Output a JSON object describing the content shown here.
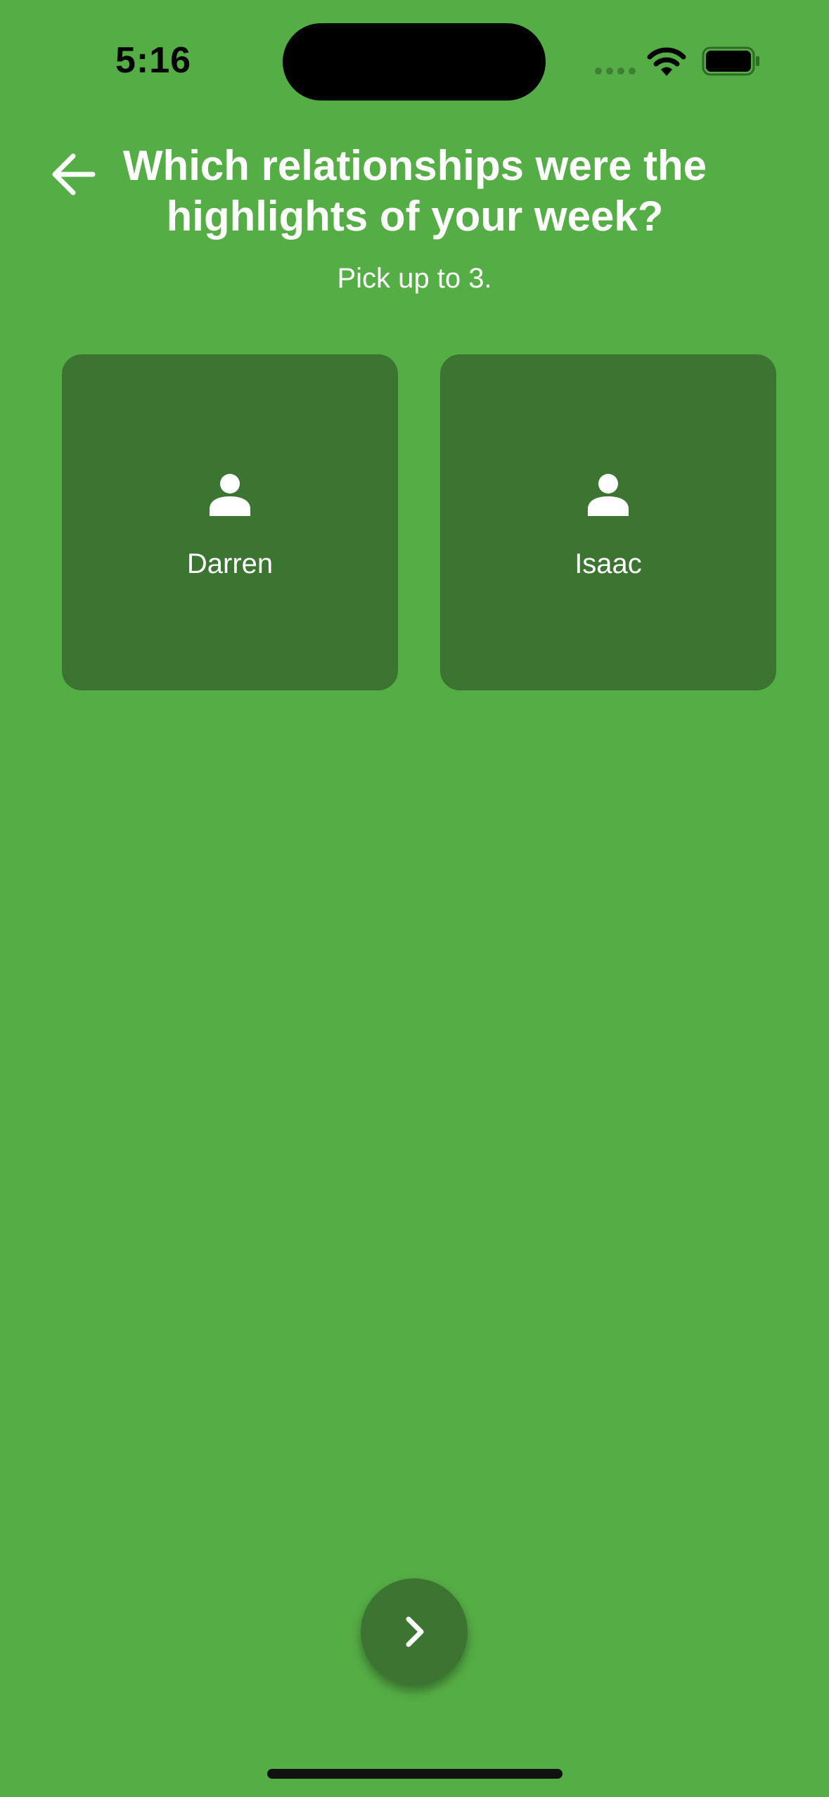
{
  "status_bar": {
    "time": "5:16",
    "icons": [
      "signal-dots-icon",
      "wifi-icon",
      "battery-icon"
    ]
  },
  "header": {
    "back_icon": "arrow-left-icon",
    "title": "Which relationships were the highlights of your week?",
    "subtitle": "Pick up to 3."
  },
  "relationships": [
    {
      "name": "Darren",
      "icon": "person-icon"
    },
    {
      "name": "Isaac",
      "icon": "person-icon"
    }
  ],
  "footer": {
    "next_icon": "chevron-right-icon"
  },
  "colors": {
    "background": "#55ad45",
    "card": "#3c7532",
    "text": "#ffffff"
  }
}
